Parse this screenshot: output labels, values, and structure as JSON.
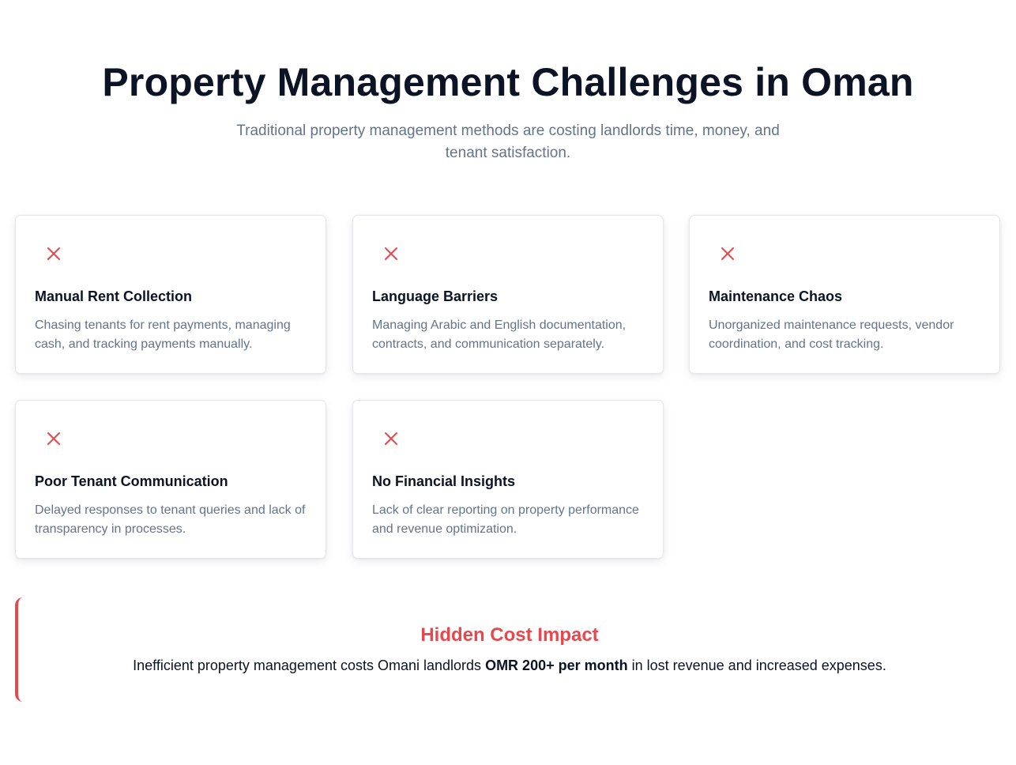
{
  "header": {
    "title": "Property Management Challenges in Oman",
    "subtitle": "Traditional property management methods are costing landlords time, money, and tenant satisfaction."
  },
  "colors": {
    "accent_red": "#e5484d",
    "heading": "#0b1324",
    "muted": "#64748b"
  },
  "challenges": [
    {
      "icon": "x-icon",
      "title": "Manual Rent Collection",
      "description": "Chasing tenants for rent payments, managing cash, and tracking payments manually."
    },
    {
      "icon": "x-icon",
      "title": "Language Barriers",
      "description": "Managing Arabic and English documentation, contracts, and communication separately."
    },
    {
      "icon": "x-icon",
      "title": "Maintenance Chaos",
      "description": "Unorganized maintenance requests, vendor coordination, and cost tracking."
    },
    {
      "icon": "x-icon",
      "title": "Poor Tenant Communication",
      "description": "Delayed responses to tenant queries and lack of transparency in processes."
    },
    {
      "icon": "x-icon",
      "title": "No Financial Insights",
      "description": "Lack of clear reporting on property performance and revenue optimization."
    }
  ],
  "impact": {
    "title": "Hidden Cost Impact",
    "text_before": "Inefficient property management costs Omani landlords ",
    "text_highlight": "OMR 200+ per month",
    "text_after": " in lost revenue and increased expenses."
  }
}
